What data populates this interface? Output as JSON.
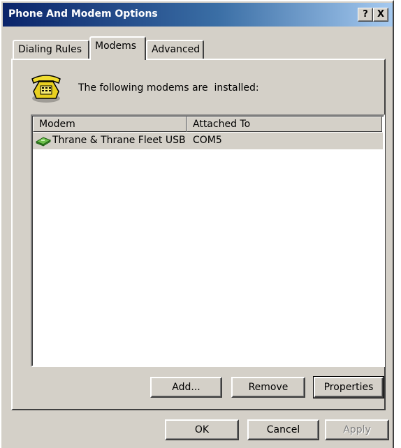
{
  "window": {
    "title": "Phone And Modem Options"
  },
  "titlebar": {
    "help": "?",
    "close": "X"
  },
  "tabs": {
    "dialing": "Dialing Rules",
    "modems": "Modems",
    "advanced": "Advanced"
  },
  "active_tab": "Modems",
  "panel": {
    "intro": "The following modems are  installed:",
    "columns": {
      "modem": "Modem",
      "attached": "Attached To"
    },
    "rows": [
      {
        "modem": "Thrane & Thrane Fleet USB",
        "attached": "COM5"
      }
    ],
    "icons": {
      "header": "telephone-icon",
      "row": "modem-icon"
    }
  },
  "panel_buttons": {
    "add": "Add...",
    "remove": "Remove",
    "properties": "Properties"
  },
  "dialog_buttons": {
    "ok": "OK",
    "cancel": "Cancel",
    "apply": "Apply"
  },
  "colors": {
    "title_bar_start": "#0a246a",
    "title_bar_end": "#a6caf0",
    "face": "#d4d0c8",
    "disabled_text": "#808080"
  }
}
